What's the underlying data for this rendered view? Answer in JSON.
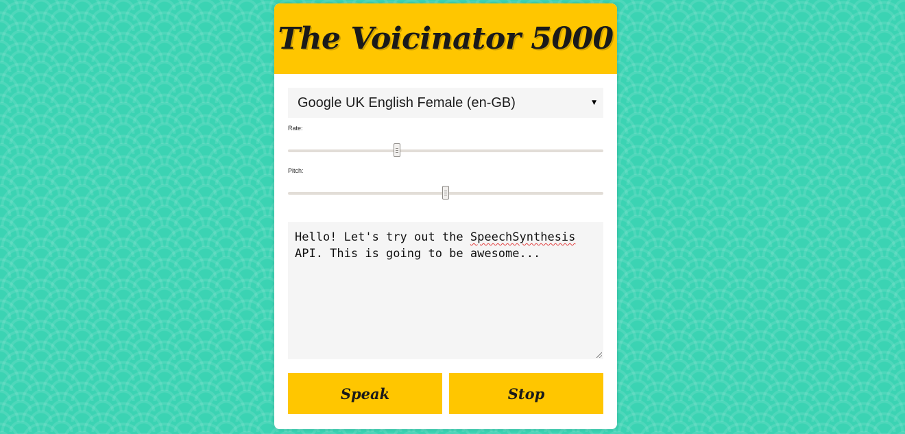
{
  "app": {
    "title": "The Voicinator 5000"
  },
  "voice_select": {
    "selected": "Google UK English Female (en-GB)",
    "arrow_icon": "triangle-down-icon"
  },
  "rate": {
    "label": "Rate:",
    "value_fraction": 0.343
  },
  "pitch": {
    "label": "Pitch:",
    "value_fraction": 0.5
  },
  "message": {
    "text_before": "Hello! Let's try out the ",
    "misspelled": "SpeechSynthesis",
    "text_after": " API. This is going to be awesome..."
  },
  "buttons": {
    "speak": "Speak",
    "stop": "Stop"
  },
  "colors": {
    "accent": "#ffc600",
    "background": "#3bd3b3",
    "panel": "#ffffff",
    "field": "#f5f5f5"
  }
}
